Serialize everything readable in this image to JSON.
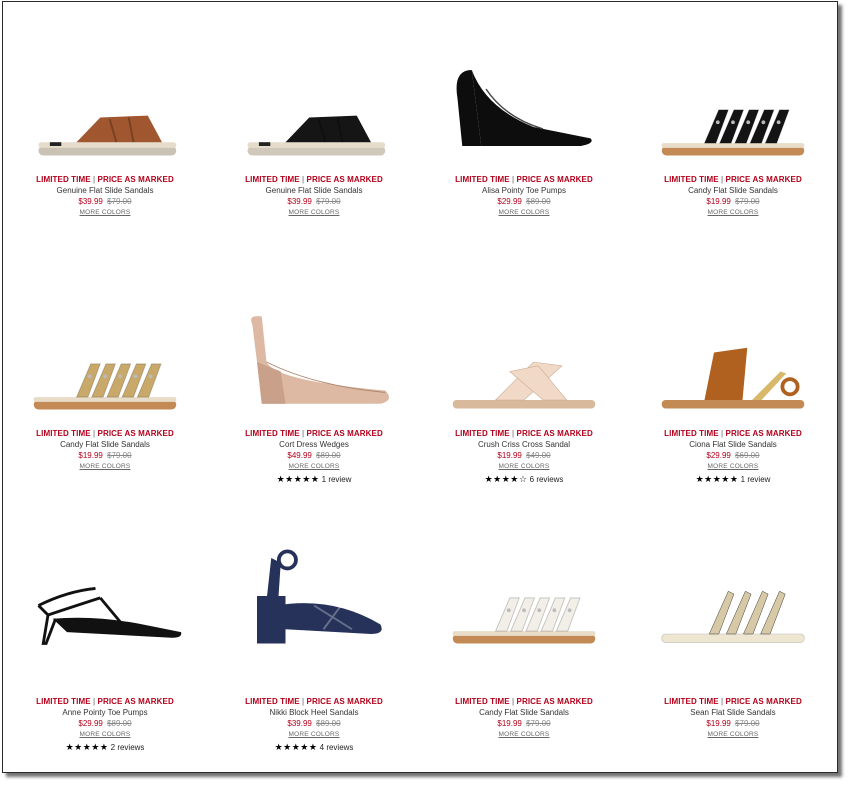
{
  "products": [
    {
      "promo_left": "LIMITED TIME",
      "promo_sep": "|",
      "promo_right": "PRICE AS MARKED",
      "name": "Genuine Flat Slide Sandals",
      "sale": "$39.99",
      "orig": "$79.00",
      "more": "MORE COLORS",
      "color": "#a0562f",
      "sole": "#c9c2b5",
      "style": "slide"
    },
    {
      "promo_left": "LIMITED TIME",
      "promo_sep": "|",
      "promo_right": "PRICE AS MARKED",
      "name": "Genuine Flat Slide Sandals",
      "sale": "$39.99",
      "orig": "$79.00",
      "more": "MORE COLORS",
      "color": "#151515",
      "sole": "#cfc8bb",
      "style": "slide"
    },
    {
      "promo_left": "LIMITED TIME",
      "promo_sep": "|",
      "promo_right": "PRICE AS MARKED",
      "name": "Alisa Pointy Toe Pumps",
      "sale": "$29.99",
      "orig": "$89.00",
      "more": "MORE COLORS",
      "color": "#0d0d0d",
      "sole": "#0d0d0d",
      "style": "pump"
    },
    {
      "promo_left": "LIMITED TIME",
      "promo_sep": "|",
      "promo_right": "PRICE AS MARKED",
      "name": "Candy Flat Slide Sandals",
      "sale": "$19.99",
      "orig": "$79.00",
      "more": "MORE COLORS",
      "color": "#141414",
      "sole": "#c48a55",
      "style": "straps"
    },
    {
      "promo_left": "LIMITED TIME",
      "promo_sep": "|",
      "promo_right": "PRICE AS MARKED",
      "name": "Candy Flat Slide Sandals",
      "sale": "$19.99",
      "orig": "$79.00",
      "more": "MORE COLORS",
      "color": "#c9a96a",
      "sole": "#c48a55",
      "style": "straps"
    },
    {
      "promo_left": "LIMITED TIME",
      "promo_sep": "|",
      "promo_right": "PRICE AS MARKED",
      "name": "Cort Dress Wedges",
      "sale": "$49.99",
      "orig": "$89.00",
      "more": "MORE COLORS",
      "color": "#ddb9a4",
      "sole": "#ddb9a4",
      "style": "wedge",
      "stars": "★★★★★",
      "reviews": "1 review"
    },
    {
      "promo_left": "LIMITED TIME",
      "promo_sep": "|",
      "promo_right": "PRICE AS MARKED",
      "name": "Crush Criss Cross Sandal",
      "sale": "$19.99",
      "orig": "$49.00",
      "more": "MORE COLORS",
      "color": "#f1d9c8",
      "sole": "#d9b99c",
      "style": "cross",
      "stars": "★★★★☆",
      "reviews": "6 reviews"
    },
    {
      "promo_left": "LIMITED TIME",
      "promo_sep": "|",
      "promo_right": "PRICE AS MARKED",
      "name": "Ciona Flat Slide Sandals",
      "sale": "$29.99",
      "orig": "$69.00",
      "more": "MORE COLORS",
      "color": "#b0601f",
      "sole": "#c48a55",
      "style": "ciona",
      "stars": "★★★★★",
      "reviews": "1 review"
    },
    {
      "promo_left": "LIMITED TIME",
      "promo_sep": "|",
      "promo_right": "PRICE AS MARKED",
      "name": "Anne Pointy Toe Pumps",
      "sale": "$29.99",
      "orig": "$89.00",
      "more": "MORE COLORS",
      "color": "#111111",
      "sole": "#111111",
      "style": "strappy-pump",
      "stars": "★★★★★",
      "reviews": "2 reviews"
    },
    {
      "promo_left": "LIMITED TIME",
      "promo_sep": "|",
      "promo_right": "PRICE AS MARKED",
      "name": "Nikki Block Heel Sandals",
      "sale": "$39.99",
      "orig": "$89.00",
      "more": "MORE COLORS",
      "color": "#26325a",
      "sole": "#26325a",
      "style": "block",
      "stars": "★★★★★",
      "reviews": "4 reviews"
    },
    {
      "promo_left": "LIMITED TIME",
      "promo_sep": "|",
      "promo_right": "PRICE AS MARKED",
      "name": "Candy Flat Slide Sandals",
      "sale": "$19.99",
      "orig": "$79.00",
      "more": "MORE COLORS",
      "color": "#f2efe8",
      "sole": "#c48a55",
      "style": "straps"
    },
    {
      "promo_left": "LIMITED TIME",
      "promo_sep": "|",
      "promo_right": "PRICE AS MARKED",
      "name": "Sean Flat Slide Sandals",
      "sale": "$19.99",
      "orig": "$79.00",
      "more": "MORE COLORS",
      "color": "#d8c9a6",
      "sole": "#efe6d2",
      "style": "sean"
    }
  ]
}
